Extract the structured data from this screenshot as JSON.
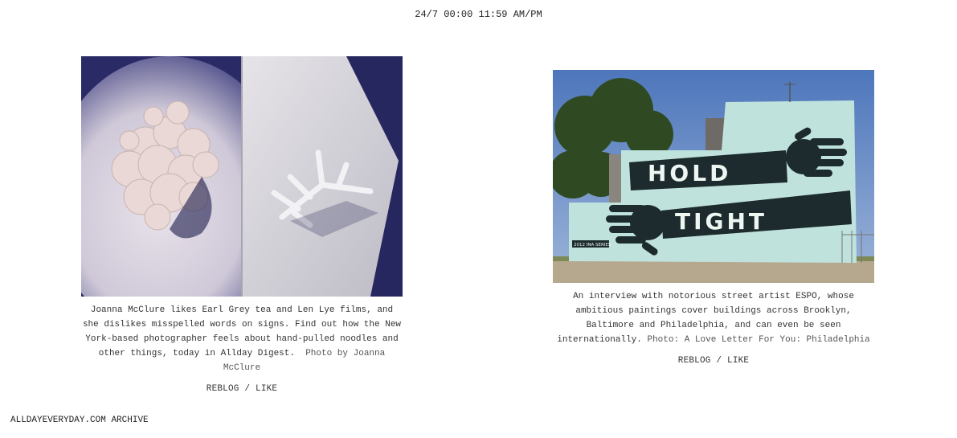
{
  "header": {
    "time_text": "24/7 00:00 11:59 AM/PM"
  },
  "posts": [
    {
      "caption": "Joanna McClure likes Earl Grey tea and Len Lye films, and she dislikes misspelled words on signs. Find out how the New York-based photographer feels about hand-pulled noodles and other things, today in Allday Digest.",
      "credit": "Photo by Joanna McClure",
      "reblog_label": "REBLOG",
      "separator": "/",
      "like_label": "LIKE"
    },
    {
      "caption": "An interview with notorious street artist ESPO, whose ambitious paintings cover buildings across Brooklyn, Baltimore and Philadelphia, and can even be seen internationally.",
      "credit": "Photo: A Love Letter For You: Philadelphia",
      "mural_line1": "HOLD",
      "mural_line2": "TIGHT",
      "mural_tag": "2012 INA SERIES",
      "reblog_label": "REBLOG",
      "separator": "/",
      "like_label": "LIKE"
    }
  ],
  "footer": {
    "site_label": "ALLDAYEVERYDAY.COM",
    "archive_label": "ARCHIVE"
  },
  "colors": {
    "text": "#333333",
    "link": "#555555",
    "photo1_bg": "#2b2b6b",
    "mural_wall": "#bfe3dc",
    "sky": "#5b84c4"
  }
}
